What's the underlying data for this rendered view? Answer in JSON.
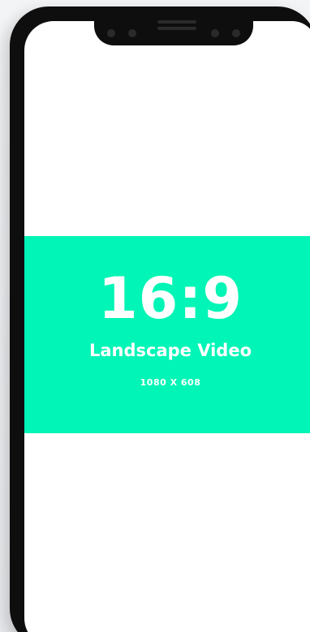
{
  "banner": {
    "ratio": "16:9",
    "title": "Landscape Video",
    "dimensions": "1080 X 608",
    "color": "#00f5b6"
  },
  "device": {
    "frame_color": "#0e0e0e",
    "screen_color": "#ffffff"
  }
}
